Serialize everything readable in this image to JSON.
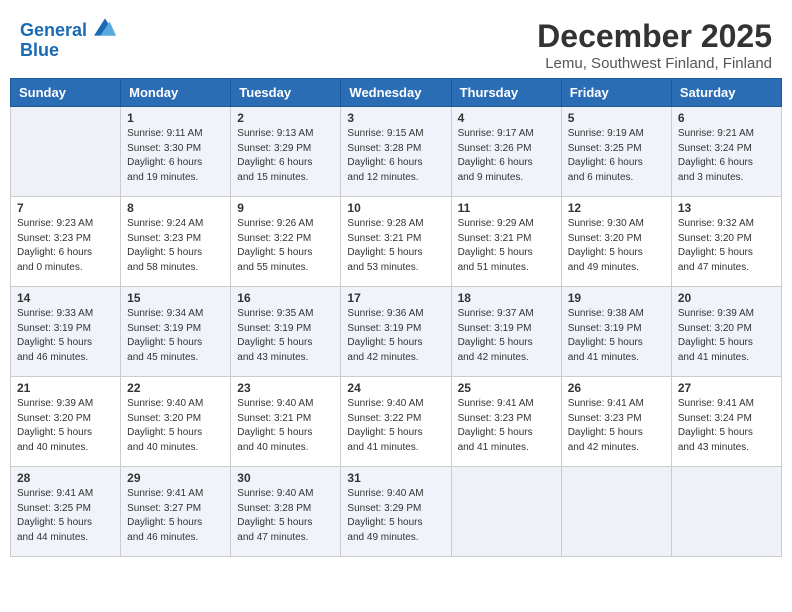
{
  "header": {
    "logo_line1": "General",
    "logo_line2": "Blue",
    "title": "December 2025",
    "subtitle": "Lemu, Southwest Finland, Finland"
  },
  "days_of_week": [
    "Sunday",
    "Monday",
    "Tuesday",
    "Wednesday",
    "Thursday",
    "Friday",
    "Saturday"
  ],
  "weeks": [
    [
      {
        "day": "",
        "info": ""
      },
      {
        "day": "1",
        "info": "Sunrise: 9:11 AM\nSunset: 3:30 PM\nDaylight: 6 hours\nand 19 minutes."
      },
      {
        "day": "2",
        "info": "Sunrise: 9:13 AM\nSunset: 3:29 PM\nDaylight: 6 hours\nand 15 minutes."
      },
      {
        "day": "3",
        "info": "Sunrise: 9:15 AM\nSunset: 3:28 PM\nDaylight: 6 hours\nand 12 minutes."
      },
      {
        "day": "4",
        "info": "Sunrise: 9:17 AM\nSunset: 3:26 PM\nDaylight: 6 hours\nand 9 minutes."
      },
      {
        "day": "5",
        "info": "Sunrise: 9:19 AM\nSunset: 3:25 PM\nDaylight: 6 hours\nand 6 minutes."
      },
      {
        "day": "6",
        "info": "Sunrise: 9:21 AM\nSunset: 3:24 PM\nDaylight: 6 hours\nand 3 minutes."
      }
    ],
    [
      {
        "day": "7",
        "info": "Sunrise: 9:23 AM\nSunset: 3:23 PM\nDaylight: 6 hours\nand 0 minutes."
      },
      {
        "day": "8",
        "info": "Sunrise: 9:24 AM\nSunset: 3:23 PM\nDaylight: 5 hours\nand 58 minutes."
      },
      {
        "day": "9",
        "info": "Sunrise: 9:26 AM\nSunset: 3:22 PM\nDaylight: 5 hours\nand 55 minutes."
      },
      {
        "day": "10",
        "info": "Sunrise: 9:28 AM\nSunset: 3:21 PM\nDaylight: 5 hours\nand 53 minutes."
      },
      {
        "day": "11",
        "info": "Sunrise: 9:29 AM\nSunset: 3:21 PM\nDaylight: 5 hours\nand 51 minutes."
      },
      {
        "day": "12",
        "info": "Sunrise: 9:30 AM\nSunset: 3:20 PM\nDaylight: 5 hours\nand 49 minutes."
      },
      {
        "day": "13",
        "info": "Sunrise: 9:32 AM\nSunset: 3:20 PM\nDaylight: 5 hours\nand 47 minutes."
      }
    ],
    [
      {
        "day": "14",
        "info": "Sunrise: 9:33 AM\nSunset: 3:19 PM\nDaylight: 5 hours\nand 46 minutes."
      },
      {
        "day": "15",
        "info": "Sunrise: 9:34 AM\nSunset: 3:19 PM\nDaylight: 5 hours\nand 45 minutes."
      },
      {
        "day": "16",
        "info": "Sunrise: 9:35 AM\nSunset: 3:19 PM\nDaylight: 5 hours\nand 43 minutes."
      },
      {
        "day": "17",
        "info": "Sunrise: 9:36 AM\nSunset: 3:19 PM\nDaylight: 5 hours\nand 42 minutes."
      },
      {
        "day": "18",
        "info": "Sunrise: 9:37 AM\nSunset: 3:19 PM\nDaylight: 5 hours\nand 42 minutes."
      },
      {
        "day": "19",
        "info": "Sunrise: 9:38 AM\nSunset: 3:19 PM\nDaylight: 5 hours\nand 41 minutes."
      },
      {
        "day": "20",
        "info": "Sunrise: 9:39 AM\nSunset: 3:20 PM\nDaylight: 5 hours\nand 41 minutes."
      }
    ],
    [
      {
        "day": "21",
        "info": "Sunrise: 9:39 AM\nSunset: 3:20 PM\nDaylight: 5 hours\nand 40 minutes."
      },
      {
        "day": "22",
        "info": "Sunrise: 9:40 AM\nSunset: 3:20 PM\nDaylight: 5 hours\nand 40 minutes."
      },
      {
        "day": "23",
        "info": "Sunrise: 9:40 AM\nSunset: 3:21 PM\nDaylight: 5 hours\nand 40 minutes."
      },
      {
        "day": "24",
        "info": "Sunrise: 9:40 AM\nSunset: 3:22 PM\nDaylight: 5 hours\nand 41 minutes."
      },
      {
        "day": "25",
        "info": "Sunrise: 9:41 AM\nSunset: 3:23 PM\nDaylight: 5 hours\nand 41 minutes."
      },
      {
        "day": "26",
        "info": "Sunrise: 9:41 AM\nSunset: 3:23 PM\nDaylight: 5 hours\nand 42 minutes."
      },
      {
        "day": "27",
        "info": "Sunrise: 9:41 AM\nSunset: 3:24 PM\nDaylight: 5 hours\nand 43 minutes."
      }
    ],
    [
      {
        "day": "28",
        "info": "Sunrise: 9:41 AM\nSunset: 3:25 PM\nDaylight: 5 hours\nand 44 minutes."
      },
      {
        "day": "29",
        "info": "Sunrise: 9:41 AM\nSunset: 3:27 PM\nDaylight: 5 hours\nand 46 minutes."
      },
      {
        "day": "30",
        "info": "Sunrise: 9:40 AM\nSunset: 3:28 PM\nDaylight: 5 hours\nand 47 minutes."
      },
      {
        "day": "31",
        "info": "Sunrise: 9:40 AM\nSunset: 3:29 PM\nDaylight: 5 hours\nand 49 minutes."
      },
      {
        "day": "",
        "info": ""
      },
      {
        "day": "",
        "info": ""
      },
      {
        "day": "",
        "info": ""
      }
    ]
  ]
}
